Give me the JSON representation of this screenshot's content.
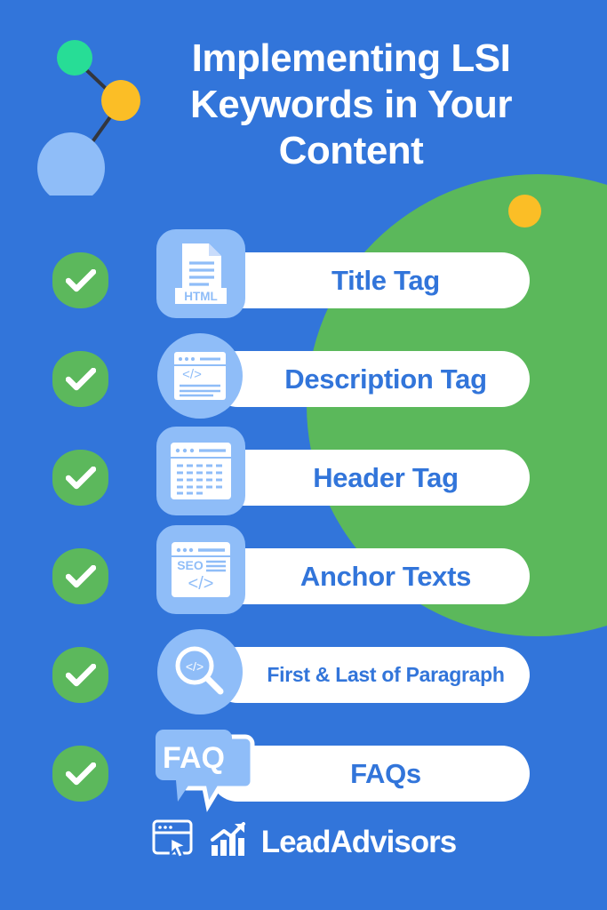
{
  "colors": {
    "background_blue": "#3275da",
    "accent_green": "#5cb85c",
    "accent_yellow": "#fbbe26",
    "accent_teal": "#27dd96",
    "icon_blue": "#8fbdf8",
    "text_white": "#ffffff",
    "pill_text_blue": "#3275da"
  },
  "header": {
    "title": "Implementing LSI\nKeywords in Your\nContent",
    "decoration": {
      "node_graph": "connected-nodes-graphic",
      "nodes": [
        {
          "name": "green-node",
          "color": "#27dd96"
        },
        {
          "name": "yellow-node",
          "color": "#fbbe26"
        },
        {
          "name": "lightblue-node",
          "color": "#8fbdf8"
        }
      ]
    }
  },
  "checklist": {
    "items": [
      {
        "check": "✓",
        "icon": "html-document-icon",
        "icon_text": "HTML",
        "label": "Title Tag",
        "badge_shape": "rounded-square",
        "small_text": false
      },
      {
        "check": "✓",
        "icon": "code-browser-icon",
        "icon_text": "</>",
        "label": "Description Tag",
        "badge_shape": "circle",
        "small_text": false
      },
      {
        "check": "✓",
        "icon": "browser-lines-icon",
        "icon_text": "",
        "label": "Header Tag",
        "badge_shape": "rounded-square",
        "small_text": false
      },
      {
        "check": "✓",
        "icon": "seo-code-browser-icon",
        "icon_text": "SEO",
        "label": "Anchor Texts",
        "badge_shape": "rounded-square",
        "small_text": false
      },
      {
        "check": "✓",
        "icon": "magnifier-code-icon",
        "icon_text": "</>",
        "label": "First & Last of Paragraph",
        "badge_shape": "circle",
        "small_text": true
      },
      {
        "check": "✓",
        "icon": "faq-speech-bubble-icon",
        "icon_text": "FAQ",
        "label": "FAQs",
        "badge_shape": "speech-bubble",
        "small_text": false
      }
    ]
  },
  "footer": {
    "logo_icon": "browser-cursor-icon",
    "chart_icon": "bar-chart-arrow-icon",
    "brand": "LeadAdvisors"
  }
}
